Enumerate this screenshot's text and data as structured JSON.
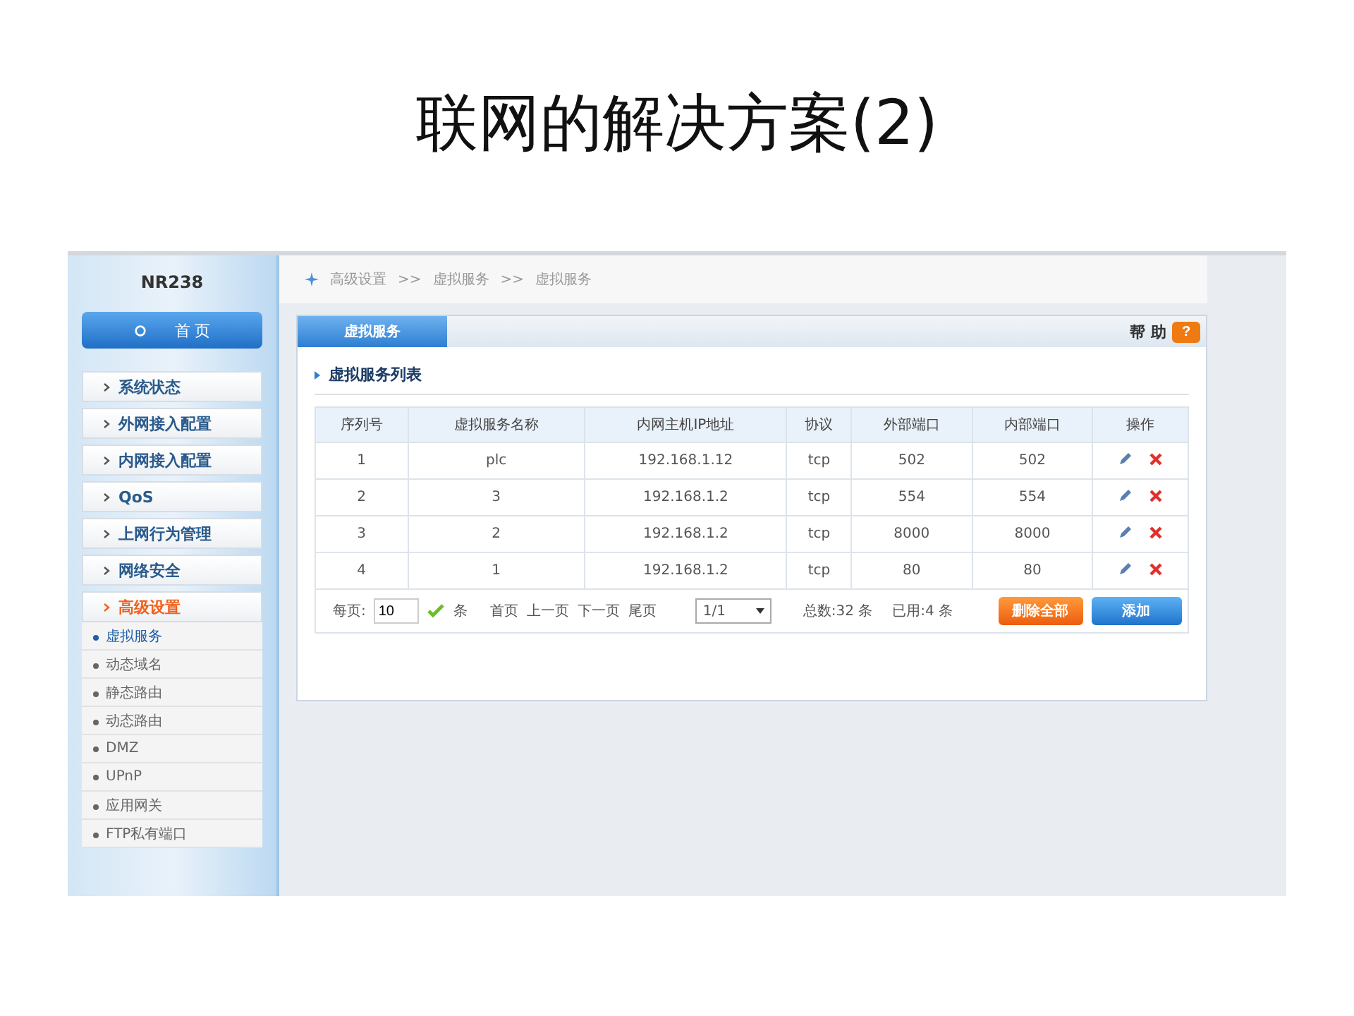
{
  "slide_title": "联网的解决方案(2)",
  "sidebar": {
    "device": "NR238",
    "home": "首 页",
    "items": [
      {
        "label": "系统状态",
        "expanded": false
      },
      {
        "label": "外网接入配置",
        "expanded": false
      },
      {
        "label": "内网接入配置",
        "expanded": false
      },
      {
        "label": "QoS",
        "expanded": false
      },
      {
        "label": "上网行为管理",
        "expanded": false
      },
      {
        "label": "网络安全",
        "expanded": false
      },
      {
        "label": "高级设置",
        "expanded": true,
        "children": [
          {
            "label": "虚拟服务",
            "selected": true
          },
          {
            "label": "动态域名",
            "selected": false
          },
          {
            "label": "静态路由",
            "selected": false
          },
          {
            "label": "动态路由",
            "selected": false
          },
          {
            "label": "DMZ",
            "selected": false
          },
          {
            "label": "UPnP",
            "selected": false
          },
          {
            "label": "应用网关",
            "selected": false
          },
          {
            "label": "FTP私有端口",
            "selected": false
          }
        ]
      }
    ]
  },
  "breadcrumb": [
    "高级设置",
    ">>",
    "虚拟服务",
    ">>",
    "虚拟服务"
  ],
  "tab": "虚拟服务",
  "help": "帮 助",
  "help_icon": "?",
  "section_title": "虚拟服务列表",
  "table": {
    "columns": [
      "序列号",
      "虚拟服务名称",
      "内网主机IP地址",
      "协议",
      "外部端口",
      "内部端口",
      "操作"
    ],
    "rows": [
      [
        "1",
        "plc",
        "192.168.1.12",
        "tcp",
        "502",
        "502"
      ],
      [
        "2",
        "3",
        "192.168.1.2",
        "tcp",
        "554",
        "554"
      ],
      [
        "3",
        "2",
        "192.168.1.2",
        "tcp",
        "8000",
        "8000"
      ],
      [
        "4",
        "1",
        "192.168.1.2",
        "tcp",
        "80",
        "80"
      ]
    ]
  },
  "pager": {
    "per_page_label": "每页:",
    "per_page": "10",
    "unit": "条",
    "links": [
      "首页",
      "上一页",
      "下一页",
      "尾页"
    ],
    "page": "1/1",
    "total": "总数:32 条",
    "used": "已用:4 条"
  },
  "buttons": [
    "删除全部",
    "添加"
  ]
}
